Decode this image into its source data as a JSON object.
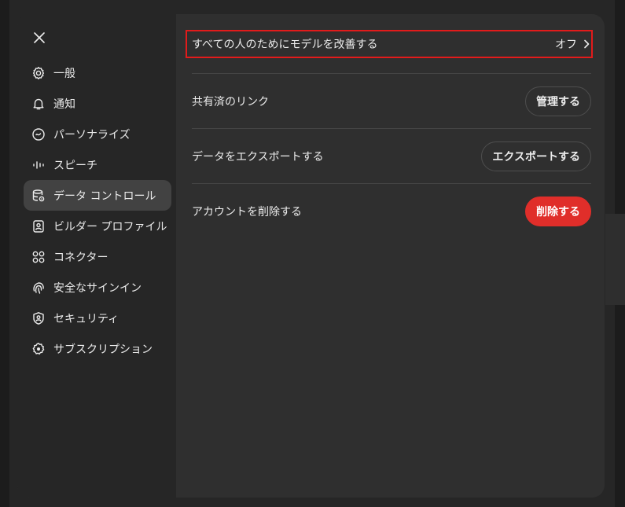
{
  "sidebar": {
    "items": [
      {
        "label": "一般",
        "icon": "gear-icon"
      },
      {
        "label": "通知",
        "icon": "bell-icon"
      },
      {
        "label": "パーソナライズ",
        "icon": "personalize-icon"
      },
      {
        "label": "スピーチ",
        "icon": "waveform-icon"
      },
      {
        "label": "データ コントロール",
        "icon": "database-icon",
        "active": true
      },
      {
        "label": "ビルダー プロファイル",
        "icon": "id-card-icon"
      },
      {
        "label": "コネクター",
        "icon": "connector-icon"
      },
      {
        "label": "安全なサインイン",
        "icon": "fingerprint-icon"
      },
      {
        "label": "セキュリティ",
        "icon": "shield-icon"
      },
      {
        "label": "サブスクリプション",
        "icon": "subscription-icon"
      }
    ]
  },
  "content": {
    "improve_model": {
      "label": "すべての人のためにモデルを改善する",
      "value": "オフ"
    },
    "shared_links": {
      "label": "共有済のリンク",
      "button": "管理する"
    },
    "export": {
      "label": "データをエクスポートする",
      "button": "エクスポートする"
    },
    "delete": {
      "label": "アカウントを削除する",
      "button": "削除する"
    }
  },
  "colors": {
    "modal_bg": "#2f2f2f",
    "sidebar_bg": "#262626",
    "active_item": "#424242",
    "danger": "#e02e2a",
    "highlight": "#e21b1b"
  }
}
